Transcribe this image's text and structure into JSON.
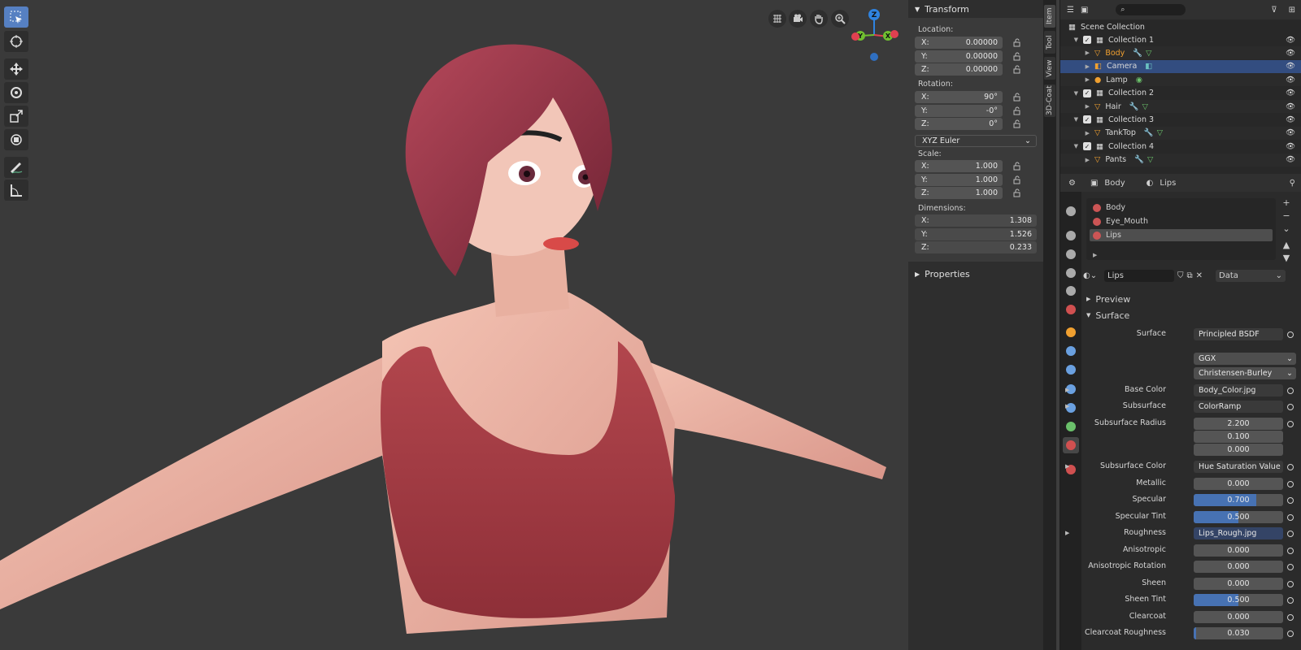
{
  "viewport": {
    "nav_gizmo": {
      "z": "Z",
      "y": "Y",
      "x": "X"
    }
  },
  "npanel": {
    "transform_label": "Transform",
    "location_label": "Location:",
    "location": [
      {
        "axis": "X:",
        "value": "0.00000"
      },
      {
        "axis": "Y:",
        "value": "0.00000"
      },
      {
        "axis": "Z:",
        "value": "0.00000"
      }
    ],
    "rotation_label": "Rotation:",
    "rotation": [
      {
        "axis": "X:",
        "value": "90°"
      },
      {
        "axis": "Y:",
        "value": "-0°"
      },
      {
        "axis": "Z:",
        "value": "0°"
      }
    ],
    "rotation_mode": "XYZ Euler",
    "scale_label": "Scale:",
    "scale": [
      {
        "axis": "X:",
        "value": "1.000"
      },
      {
        "axis": "Y:",
        "value": "1.000"
      },
      {
        "axis": "Z:",
        "value": "1.000"
      }
    ],
    "dimensions_label": "Dimensions:",
    "dimensions": [
      {
        "axis": "X:",
        "value": "1.308"
      },
      {
        "axis": "Y:",
        "value": "1.526"
      },
      {
        "axis": "Z:",
        "value": "0.233"
      }
    ],
    "properties_label": "Properties"
  },
  "side_tabs": [
    "Item",
    "Tool",
    "View",
    "3D-Coat"
  ],
  "outliner": {
    "root": "Scene Collection",
    "rows": [
      {
        "label": "Collection 1",
        "type": "collection"
      },
      {
        "label": "Body",
        "type": "mesh"
      },
      {
        "label": "Camera",
        "type": "camera"
      },
      {
        "label": "Lamp",
        "type": "light"
      },
      {
        "label": "Collection 2",
        "type": "collection"
      },
      {
        "label": "Hair",
        "type": "mesh"
      },
      {
        "label": "Collection 3",
        "type": "collection"
      },
      {
        "label": "TankTop",
        "type": "mesh"
      },
      {
        "label": "Collection 4",
        "type": "collection"
      },
      {
        "label": "Pants",
        "type": "mesh"
      }
    ]
  },
  "properties": {
    "breadcrumb": {
      "object": "Body",
      "material": "Lips"
    },
    "slots": [
      "Body",
      "Eye_Mouth",
      "Lips"
    ],
    "material_name": "Lips",
    "link_mode": "Data",
    "preview_label": "Preview",
    "surface_panel_label": "Surface",
    "surface": {
      "label": "Surface",
      "value": "Principled BSDF"
    },
    "distribution": "GGX",
    "subsurface_method": "Christensen-Burley",
    "fields": [
      {
        "label": "Base Color",
        "value": "Body_Color.jpg",
        "kind": "link"
      },
      {
        "label": "Subsurface",
        "value": "ColorRamp",
        "kind": "link"
      },
      {
        "label": "Subsurface Radius",
        "value": "2.200",
        "kind": "num"
      },
      {
        "label": "",
        "value": "0.100",
        "kind": "num"
      },
      {
        "label": "",
        "value": "0.000",
        "kind": "num"
      },
      {
        "label": "Subsurface Color",
        "value": "Hue Saturation Value",
        "kind": "link"
      },
      {
        "label": "Metallic",
        "value": "0.000",
        "kind": "slider",
        "fraction": 0
      },
      {
        "label": "Specular",
        "value": "0.700",
        "kind": "slider",
        "fraction": 0.7
      },
      {
        "label": "Specular Tint",
        "value": "0.500",
        "kind": "slider",
        "fraction": 0.5
      },
      {
        "label": "Roughness",
        "value": "Lips_Rough.jpg",
        "kind": "link"
      },
      {
        "label": "Anisotropic",
        "value": "0.000",
        "kind": "slider",
        "fraction": 0
      },
      {
        "label": "Anisotropic Rotation",
        "value": "0.000",
        "kind": "slider",
        "fraction": 0
      },
      {
        "label": "Sheen",
        "value": "0.000",
        "kind": "slider",
        "fraction": 0
      },
      {
        "label": "Sheen Tint",
        "value": "0.500",
        "kind": "slider",
        "fraction": 0.5
      },
      {
        "label": "Clearcoat",
        "value": "0.000",
        "kind": "slider",
        "fraction": 0
      },
      {
        "label": "Clearcoat Roughness",
        "value": "0.030",
        "kind": "slider",
        "fraction": 0.03
      }
    ]
  },
  "colors": {
    "accent": "#4772b3",
    "selection": "#334d80",
    "active_object": "#f0a030"
  }
}
